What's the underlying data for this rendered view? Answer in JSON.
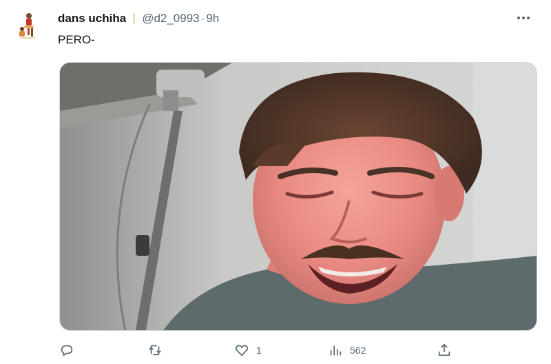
{
  "tweet": {
    "display_name": "dans uchiha",
    "handle": "@d2_0993",
    "separator": "·",
    "time": "9h",
    "text": "PERO-",
    "more_label": "···"
  },
  "media": {
    "description_icon": "photo"
  },
  "actions": {
    "reply": {
      "icon": "reply-icon",
      "count": ""
    },
    "retweet": {
      "icon": "retweet-icon",
      "count": ""
    },
    "like": {
      "icon": "heart-icon",
      "count": "1"
    },
    "views": {
      "icon": "views-icon",
      "count": "562"
    },
    "share": {
      "icon": "share-icon",
      "count": ""
    }
  },
  "colors": {
    "text_primary": "#0f1419",
    "text_secondary": "#536471",
    "border": "#cfd9de"
  }
}
